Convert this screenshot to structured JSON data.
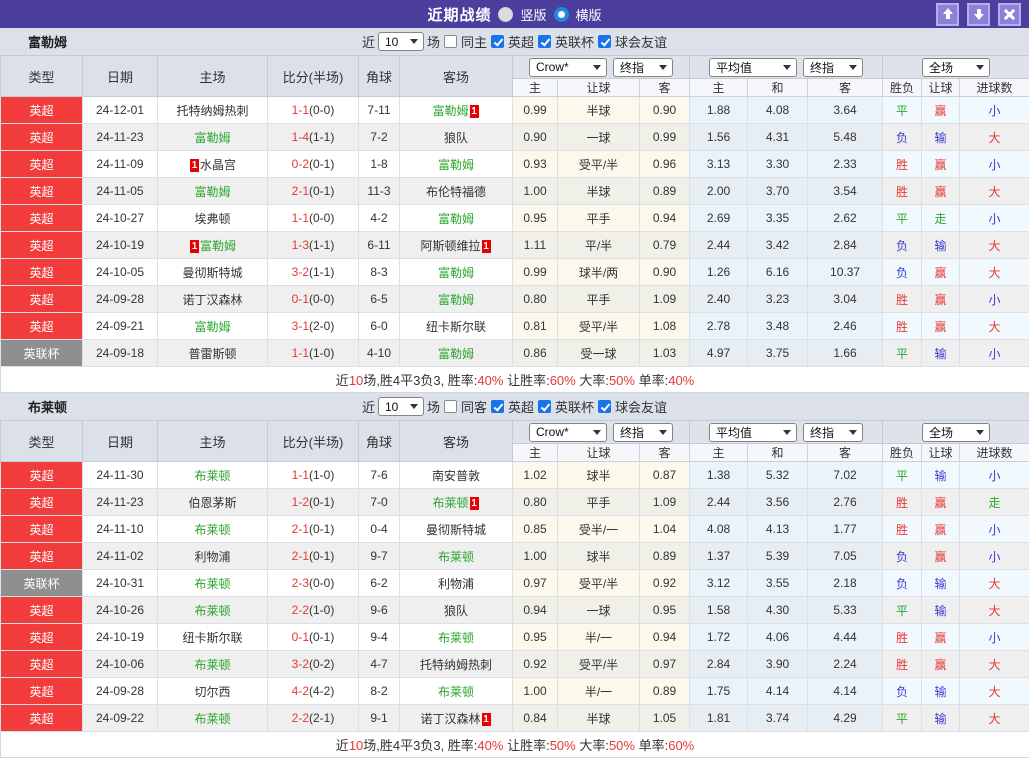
{
  "titlebar": {
    "title": "近期战绩",
    "vertical_label": "竖版",
    "horizontal_label": "横版",
    "icons": {
      "up": "arrow-up",
      "down": "arrow-down",
      "close": "close"
    }
  },
  "colors": {
    "topbar": "#4b3e9c",
    "league_red": "#f23c3c",
    "league_gray": "#8f8f8f",
    "team_green": "#2ba52e",
    "score_red": "#e53935",
    "result_blue": "#3b3bd4",
    "check_blue": "#1a73e8"
  },
  "card_badge": "1",
  "filter": {
    "near": "近",
    "unit": "场",
    "count": "10",
    "leagues": [
      "英超",
      "英联杯",
      "球会友谊"
    ]
  },
  "selects": {
    "odds_source": "Crow*",
    "final": "终指",
    "average": "平均值",
    "fullmatch": "全场"
  },
  "header": {
    "type": "类型",
    "date": "日期",
    "home": "主场",
    "score": "比分(半场)",
    "corner": "角球",
    "away": "客场",
    "sub": [
      "主",
      "让球",
      "客",
      "主",
      "和",
      "客",
      "胜负",
      "让球",
      "进球数"
    ]
  },
  "sections": [
    {
      "team": "富勒姆",
      "same_label": "同主",
      "rows": [
        {
          "type": "英超",
          "type_style": "red",
          "date": "24-12-01",
          "home": "托特纳姆热刺",
          "home_self": false,
          "home_card": false,
          "score": "1-1",
          "half": "(0-0)",
          "corner": "7-11",
          "away": "富勒姆",
          "away_self": true,
          "away_card": true,
          "odds_home": "0.99",
          "handicap": "半球",
          "odds_away": "0.90",
          "avg_home": "1.88",
          "avg_draw": "4.08",
          "avg_away": "3.64",
          "result": "平",
          "result_color": "green",
          "handicap_result": "赢",
          "handicap_color": "red",
          "goals": "小",
          "goals_color": "blue"
        },
        {
          "type": "英超",
          "type_style": "red",
          "date": "24-11-23",
          "home": "富勒姆",
          "home_self": true,
          "home_card": false,
          "score": "1-4",
          "half": "(1-1)",
          "corner": "7-2",
          "away": "狼队",
          "away_self": false,
          "away_card": false,
          "odds_home": "0.90",
          "handicap": "一球",
          "odds_away": "0.99",
          "avg_home": "1.56",
          "avg_draw": "4.31",
          "avg_away": "5.48",
          "result": "负",
          "result_color": "blue",
          "handicap_result": "输",
          "handicap_color": "blue",
          "goals": "大",
          "goals_color": "red"
        },
        {
          "type": "英超",
          "type_style": "red",
          "date": "24-11-09",
          "home": "水晶宫",
          "home_self": false,
          "home_card": true,
          "score": "0-2",
          "half": "(0-1)",
          "corner": "1-8",
          "away": "富勒姆",
          "away_self": true,
          "away_card": false,
          "odds_home": "0.93",
          "handicap": "受平/半",
          "odds_away": "0.96",
          "avg_home": "3.13",
          "avg_draw": "3.30",
          "avg_away": "2.33",
          "result": "胜",
          "result_color": "red",
          "handicap_result": "赢",
          "handicap_color": "red",
          "goals": "小",
          "goals_color": "blue"
        },
        {
          "type": "英超",
          "type_style": "red",
          "date": "24-11-05",
          "home": "富勒姆",
          "home_self": true,
          "home_card": false,
          "score": "2-1",
          "half": "(0-1)",
          "corner": "11-3",
          "away": "布伦特福德",
          "away_self": false,
          "away_card": false,
          "odds_home": "1.00",
          "handicap": "半球",
          "odds_away": "0.89",
          "avg_home": "2.00",
          "avg_draw": "3.70",
          "avg_away": "3.54",
          "result": "胜",
          "result_color": "red",
          "handicap_result": "赢",
          "handicap_color": "red",
          "goals": "大",
          "goals_color": "red"
        },
        {
          "type": "英超",
          "type_style": "red",
          "date": "24-10-27",
          "home": "埃弗顿",
          "home_self": false,
          "home_card": false,
          "score": "1-1",
          "half": "(0-0)",
          "corner": "4-2",
          "away": "富勒姆",
          "away_self": true,
          "away_card": false,
          "odds_home": "0.95",
          "handicap": "平手",
          "odds_away": "0.94",
          "avg_home": "2.69",
          "avg_draw": "3.35",
          "avg_away": "2.62",
          "result": "平",
          "result_color": "green",
          "handicap_result": "走",
          "handicap_color": "green",
          "goals": "小",
          "goals_color": "blue"
        },
        {
          "type": "英超",
          "type_style": "red",
          "date": "24-10-19",
          "home": "富勒姆",
          "home_self": true,
          "home_card": true,
          "score": "1-3",
          "half": "(1-1)",
          "corner": "6-11",
          "away": "阿斯顿维拉",
          "away_self": false,
          "away_card": true,
          "odds_home": "1.11",
          "handicap": "平/半",
          "odds_away": "0.79",
          "avg_home": "2.44",
          "avg_draw": "3.42",
          "avg_away": "2.84",
          "result": "负",
          "result_color": "blue",
          "handicap_result": "输",
          "handicap_color": "blue",
          "goals": "大",
          "goals_color": "red"
        },
        {
          "type": "英超",
          "type_style": "red",
          "date": "24-10-05",
          "home": "曼彻斯特城",
          "home_self": false,
          "home_card": false,
          "score": "3-2",
          "half": "(1-1)",
          "corner": "8-3",
          "away": "富勒姆",
          "away_self": true,
          "away_card": false,
          "odds_home": "0.99",
          "handicap": "球半/两",
          "odds_away": "0.90",
          "avg_home": "1.26",
          "avg_draw": "6.16",
          "avg_away": "10.37",
          "result": "负",
          "result_color": "blue",
          "handicap_result": "赢",
          "handicap_color": "red",
          "goals": "大",
          "goals_color": "red"
        },
        {
          "type": "英超",
          "type_style": "red",
          "date": "24-09-28",
          "home": "诺丁汉森林",
          "home_self": false,
          "home_card": false,
          "score": "0-1",
          "half": "(0-0)",
          "corner": "6-5",
          "away": "富勒姆",
          "away_self": true,
          "away_card": false,
          "odds_home": "0.80",
          "handicap": "平手",
          "odds_away": "1.09",
          "avg_home": "2.40",
          "avg_draw": "3.23",
          "avg_away": "3.04",
          "result": "胜",
          "result_color": "red",
          "handicap_result": "赢",
          "handicap_color": "red",
          "goals": "小",
          "goals_color": "blue"
        },
        {
          "type": "英超",
          "type_style": "red",
          "date": "24-09-21",
          "home": "富勒姆",
          "home_self": true,
          "home_card": false,
          "score": "3-1",
          "half": "(2-0)",
          "corner": "6-0",
          "away": "纽卡斯尔联",
          "away_self": false,
          "away_card": false,
          "odds_home": "0.81",
          "handicap": "受平/半",
          "odds_away": "1.08",
          "avg_home": "2.78",
          "avg_draw": "3.48",
          "avg_away": "2.46",
          "result": "胜",
          "result_color": "red",
          "handicap_result": "赢",
          "handicap_color": "red",
          "goals": "大",
          "goals_color": "red"
        },
        {
          "type": "英联杯",
          "type_style": "gray",
          "date": "24-09-18",
          "home": "普雷斯顿",
          "home_self": false,
          "home_card": false,
          "score": "1-1",
          "half": "(1-0)",
          "corner": "4-10",
          "away": "富勒姆",
          "away_self": true,
          "away_card": false,
          "odds_home": "0.86",
          "handicap": "受一球",
          "odds_away": "1.03",
          "avg_home": "4.97",
          "avg_draw": "3.75",
          "avg_away": "1.66",
          "result": "平",
          "result_color": "green",
          "handicap_result": "输",
          "handicap_color": "blue",
          "goals": "小",
          "goals_color": "blue"
        }
      ],
      "summary": [
        {
          "text": "近",
          "red": false
        },
        {
          "text": "10",
          "red": true
        },
        {
          "text": "场,胜4平3负3, 胜率:",
          "red": false
        },
        {
          "text": "40%",
          "red": true
        },
        {
          "text": " 让胜率:",
          "red": false
        },
        {
          "text": "60%",
          "red": true
        },
        {
          "text": " 大率:",
          "red": false
        },
        {
          "text": "50%",
          "red": true
        },
        {
          "text": " 单率:",
          "red": false
        },
        {
          "text": "40%",
          "red": true
        }
      ]
    },
    {
      "team": "布莱顿",
      "same_label": "同客",
      "rows": [
        {
          "type": "英超",
          "type_style": "red",
          "date": "24-11-30",
          "home": "布莱顿",
          "home_self": true,
          "home_card": false,
          "score": "1-1",
          "half": "(1-0)",
          "corner": "7-6",
          "away": "南安普敦",
          "away_self": false,
          "away_card": false,
          "odds_home": "1.02",
          "handicap": "球半",
          "odds_away": "0.87",
          "avg_home": "1.38",
          "avg_draw": "5.32",
          "avg_away": "7.02",
          "result": "平",
          "result_color": "green",
          "handicap_result": "输",
          "handicap_color": "blue",
          "goals": "小",
          "goals_color": "blue"
        },
        {
          "type": "英超",
          "type_style": "red",
          "date": "24-11-23",
          "home": "伯恩茅斯",
          "home_self": false,
          "home_card": false,
          "score": "1-2",
          "half": "(0-1)",
          "corner": "7-0",
          "away": "布莱顿",
          "away_self": true,
          "away_card": true,
          "odds_home": "0.80",
          "handicap": "平手",
          "odds_away": "1.09",
          "avg_home": "2.44",
          "avg_draw": "3.56",
          "avg_away": "2.76",
          "result": "胜",
          "result_color": "red",
          "handicap_result": "赢",
          "handicap_color": "red",
          "goals": "走",
          "goals_color": "green"
        },
        {
          "type": "英超",
          "type_style": "red",
          "date": "24-11-10",
          "home": "布莱顿",
          "home_self": true,
          "home_card": false,
          "score": "2-1",
          "half": "(0-1)",
          "corner": "0-4",
          "away": "曼彻斯特城",
          "away_self": false,
          "away_card": false,
          "odds_home": "0.85",
          "handicap": "受半/一",
          "odds_away": "1.04",
          "avg_home": "4.08",
          "avg_draw": "4.13",
          "avg_away": "1.77",
          "result": "胜",
          "result_color": "red",
          "handicap_result": "赢",
          "handicap_color": "red",
          "goals": "小",
          "goals_color": "blue"
        },
        {
          "type": "英超",
          "type_style": "red",
          "date": "24-11-02",
          "home": "利物浦",
          "home_self": false,
          "home_card": false,
          "score": "2-1",
          "half": "(0-1)",
          "corner": "9-7",
          "away": "布莱顿",
          "away_self": true,
          "away_card": false,
          "odds_home": "1.00",
          "handicap": "球半",
          "odds_away": "0.89",
          "avg_home": "1.37",
          "avg_draw": "5.39",
          "avg_away": "7.05",
          "result": "负",
          "result_color": "blue",
          "handicap_result": "赢",
          "handicap_color": "red",
          "goals": "小",
          "goals_color": "blue"
        },
        {
          "type": "英联杯",
          "type_style": "gray",
          "date": "24-10-31",
          "home": "布莱顿",
          "home_self": true,
          "home_card": false,
          "score": "2-3",
          "half": "(0-0)",
          "corner": "6-2",
          "away": "利物浦",
          "away_self": false,
          "away_card": false,
          "odds_home": "0.97",
          "handicap": "受平/半",
          "odds_away": "0.92",
          "avg_home": "3.12",
          "avg_draw": "3.55",
          "avg_away": "2.18",
          "result": "负",
          "result_color": "blue",
          "handicap_result": "输",
          "handicap_color": "blue",
          "goals": "大",
          "goals_color": "red"
        },
        {
          "type": "英超",
          "type_style": "red",
          "date": "24-10-26",
          "home": "布莱顿",
          "home_self": true,
          "home_card": false,
          "score": "2-2",
          "half": "(1-0)",
          "corner": "9-6",
          "away": "狼队",
          "away_self": false,
          "away_card": false,
          "odds_home": "0.94",
          "handicap": "一球",
          "odds_away": "0.95",
          "avg_home": "1.58",
          "avg_draw": "4.30",
          "avg_away": "5.33",
          "result": "平",
          "result_color": "green",
          "handicap_result": "输",
          "handicap_color": "blue",
          "goals": "大",
          "goals_color": "red"
        },
        {
          "type": "英超",
          "type_style": "red",
          "date": "24-10-19",
          "home": "纽卡斯尔联",
          "home_self": false,
          "home_card": false,
          "score": "0-1",
          "half": "(0-1)",
          "corner": "9-4",
          "away": "布莱顿",
          "away_self": true,
          "away_card": false,
          "odds_home": "0.95",
          "handicap": "半/一",
          "odds_away": "0.94",
          "avg_home": "1.72",
          "avg_draw": "4.06",
          "avg_away": "4.44",
          "result": "胜",
          "result_color": "red",
          "handicap_result": "赢",
          "handicap_color": "red",
          "goals": "小",
          "goals_color": "blue"
        },
        {
          "type": "英超",
          "type_style": "red",
          "date": "24-10-06",
          "home": "布莱顿",
          "home_self": true,
          "home_card": false,
          "score": "3-2",
          "half": "(0-2)",
          "corner": "4-7",
          "away": "托特纳姆热刺",
          "away_self": false,
          "away_card": false,
          "odds_home": "0.92",
          "handicap": "受平/半",
          "odds_away": "0.97",
          "avg_home": "2.84",
          "avg_draw": "3.90",
          "avg_away": "2.24",
          "result": "胜",
          "result_color": "red",
          "handicap_result": "赢",
          "handicap_color": "red",
          "goals": "大",
          "goals_color": "red"
        },
        {
          "type": "英超",
          "type_style": "red",
          "date": "24-09-28",
          "home": "切尔西",
          "home_self": false,
          "home_card": false,
          "score": "4-2",
          "half": "(4-2)",
          "corner": "8-2",
          "away": "布莱顿",
          "away_self": true,
          "away_card": false,
          "odds_home": "1.00",
          "handicap": "半/一",
          "odds_away": "0.89",
          "avg_home": "1.75",
          "avg_draw": "4.14",
          "avg_away": "4.14",
          "result": "负",
          "result_color": "blue",
          "handicap_result": "输",
          "handicap_color": "blue",
          "goals": "大",
          "goals_color": "red"
        },
        {
          "type": "英超",
          "type_style": "red",
          "date": "24-09-22",
          "home": "布莱顿",
          "home_self": true,
          "home_card": false,
          "score": "2-2",
          "half": "(2-1)",
          "corner": "9-1",
          "away": "诺丁汉森林",
          "away_self": false,
          "away_card": true,
          "odds_home": "0.84",
          "handicap": "半球",
          "odds_away": "1.05",
          "avg_home": "1.81",
          "avg_draw": "3.74",
          "avg_away": "4.29",
          "result": "平",
          "result_color": "green",
          "handicap_result": "输",
          "handicap_color": "blue",
          "goals": "大",
          "goals_color": "red"
        }
      ],
      "summary": [
        {
          "text": "近",
          "red": false
        },
        {
          "text": "10",
          "red": true
        },
        {
          "text": "场,胜4平3负3, 胜率:",
          "red": false
        },
        {
          "text": "40%",
          "red": true
        },
        {
          "text": " 让胜率:",
          "red": false
        },
        {
          "text": "50%",
          "red": true
        },
        {
          "text": " 大率:",
          "red": false
        },
        {
          "text": "50%",
          "red": true
        },
        {
          "text": " 单率:",
          "red": false
        },
        {
          "text": "60%",
          "red": true
        }
      ]
    }
  ]
}
